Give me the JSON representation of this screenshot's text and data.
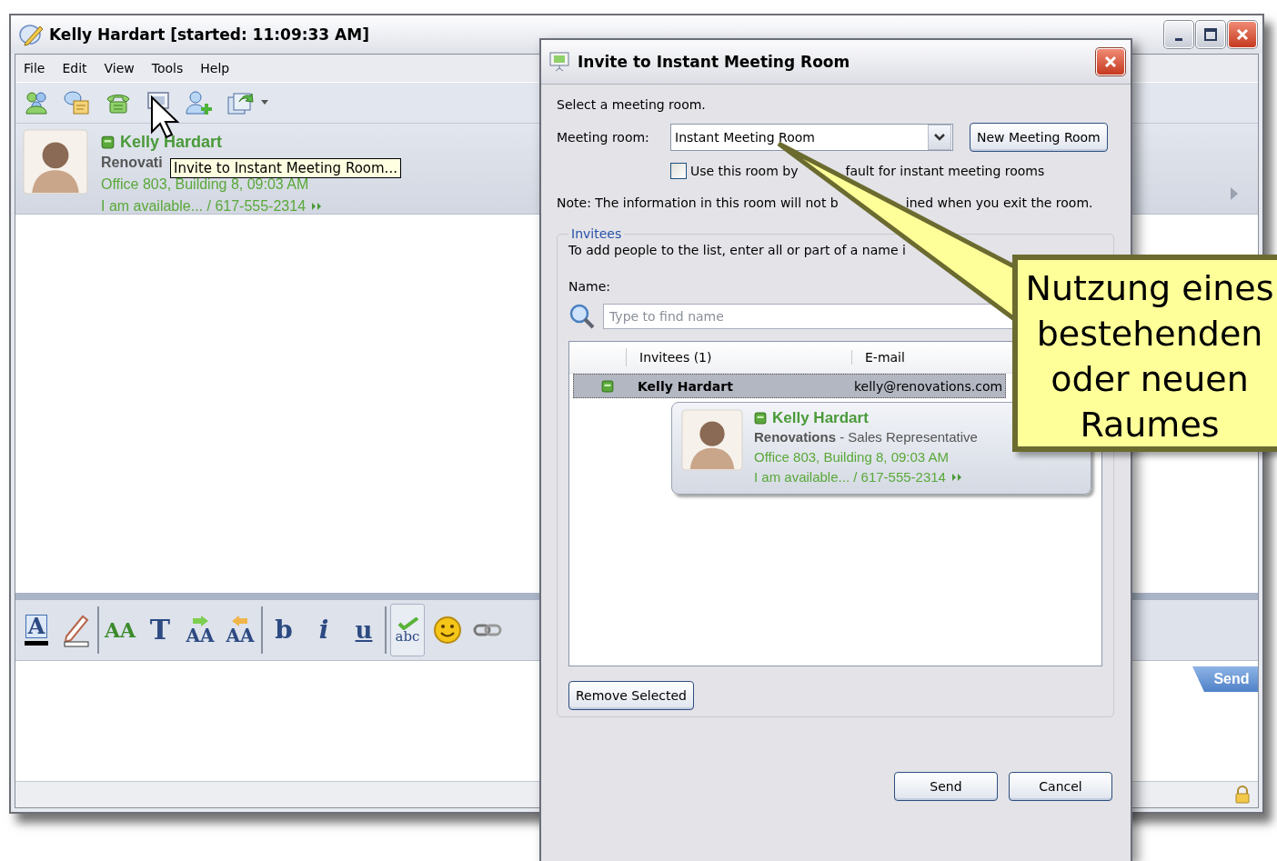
{
  "main_window": {
    "title": "Kelly Hardart [started: 11:09:33 AM]",
    "menu": [
      "File",
      "Edit",
      "View",
      "Tools",
      "Help"
    ],
    "contact": {
      "name": "Kelly Hardart",
      "company": "Renovati",
      "location": "Office 803, Building 8, 09:03 AM",
      "status": "I am available... / 617-555-2314"
    },
    "tooltip": "Invite to Instant Meeting Room...",
    "format_toolbar": [
      [
        {
          "kind": "text-color",
          "glyph": "A",
          "pressed": false
        },
        {
          "kind": "highlight",
          "pressed": false
        }
      ],
      [
        {
          "kind": "font",
          "glyph": "AA",
          "pressed": false
        },
        {
          "kind": "glyph",
          "glyph": "T",
          "pressed": false
        },
        {
          "kind": "grow",
          "glyph": "AA",
          "pressed": false
        },
        {
          "kind": "shrink",
          "glyph": "AA",
          "pressed": false
        }
      ],
      [
        {
          "kind": "bold",
          "glyph": "b",
          "pressed": false
        },
        {
          "kind": "italic",
          "glyph": "i",
          "pressed": false
        },
        {
          "kind": "underline",
          "glyph": "u",
          "pressed": false
        }
      ],
      [
        {
          "kind": "spellcheck",
          "glyph": "abc",
          "pressed": true
        },
        {
          "kind": "emoticon",
          "pressed": false
        },
        {
          "kind": "link",
          "pressed": false
        }
      ]
    ],
    "send_tab": "Send"
  },
  "dialog": {
    "title": "Invite to Instant Meeting Room",
    "prompt": "Select a meeting room.",
    "meeting_room_label": "Meeting room:",
    "meeting_room_value": "Instant Meeting Room",
    "new_room_button": "New Meeting Room",
    "default_checkbox": {
      "label_parts": [
        "Use this room by",
        "fault for instant meeting rooms"
      ],
      "checked": false
    },
    "note_parts": [
      "Note: The information in this room will not b",
      "ined when you exit the room."
    ],
    "invitees": {
      "legend": "Invitees",
      "instruction": "To add people to the list, enter all or part of a name i",
      "name_label": "Name:",
      "search_placeholder": "Type to find name",
      "columns": [
        "Invitees (1)",
        "E-mail"
      ],
      "rows": [
        {
          "name": "Kelly Hardart",
          "email": "kelly@renovations.com",
          "selected": true
        }
      ],
      "card": {
        "name": "Kelly Hardart",
        "company": "Renovations",
        "role": "- Sales Representative",
        "location": "Office 803, Building 8, 09:03 AM",
        "status": "I am available... / 617-555-2314"
      },
      "remove_button": "Remove Selected"
    },
    "buttons": [
      "Send",
      "Cancel"
    ]
  },
  "callout": {
    "text": "Nutzung eines bestehenden oder neuen Raumes"
  }
}
